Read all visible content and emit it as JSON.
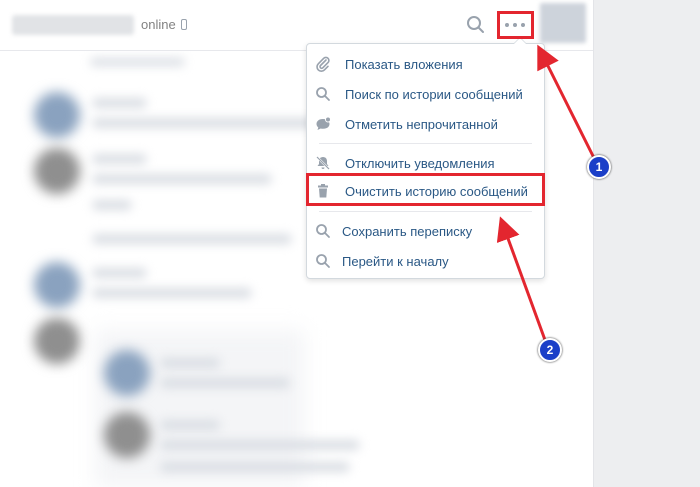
{
  "header": {
    "status": "online"
  },
  "menu": {
    "items": [
      {
        "label": "Показать вложения",
        "icon": "paperclip-icon"
      },
      {
        "label": "Поиск по истории сообщений",
        "icon": "search-icon"
      },
      {
        "label": "Отметить непрочитанной",
        "icon": "unread-bubble-icon"
      },
      {
        "label": "Отключить уведомления",
        "icon": "mute-icon"
      },
      {
        "label": "Очистить историю сообщений",
        "icon": "trash-icon"
      },
      {
        "label": "Сохранить переписку",
        "icon": "search-icon"
      },
      {
        "label": "Перейти к началу",
        "icon": "search-icon"
      }
    ]
  },
  "annotations": {
    "badge_1": "1",
    "badge_2": "2",
    "highlight_color": "#e3262f",
    "badge_color": "#1b3fc8"
  },
  "colors": {
    "link": "#2a5885",
    "icon": "#99a2ad",
    "sidebar_bg": "#edeef0"
  }
}
